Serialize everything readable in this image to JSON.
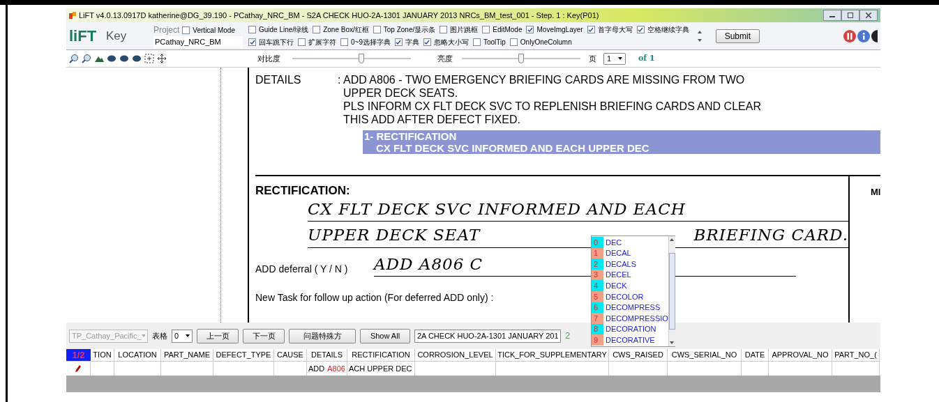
{
  "window": {
    "title": "LiFT v4.0.13.0917D katherine@DG_39.190 - PCathay_NRC_BM - S2A CHECK HUO-2A-1301 JANUARY 2013 NRCs_BM_test_001 - Step. 1 : Key(P01)"
  },
  "toolbar": {
    "logo": "liFT",
    "mode": "Key",
    "project_label": "Project",
    "project_value": "PCathay_NRC_BM",
    "submit": "Submit",
    "options_row_1": [
      {
        "label": "Vertical Mode",
        "checked": false
      },
      {
        "label": "Guide Line/绿线",
        "checked": false
      },
      {
        "label": "Zone Box/红框",
        "checked": false
      },
      {
        "label": "Top Zone/显示条",
        "checked": false
      },
      {
        "label": "图片跳框",
        "checked": false
      },
      {
        "label": "EditMode",
        "checked": false
      },
      {
        "label": "MoveImgLayer",
        "checked": true
      },
      {
        "label": "首字母大写",
        "checked": true
      },
      {
        "label": "空格继续字典",
        "checked": true
      }
    ],
    "options_row_2": [
      {
        "label": "回车跳下行",
        "checked": true
      },
      {
        "label": "扩展字符",
        "checked": false
      },
      {
        "label": "0~9选择字典",
        "checked": false
      },
      {
        "label": "字典",
        "checked": true
      },
      {
        "label": "忽略大小写",
        "checked": true
      },
      {
        "label": "ToolTip",
        "checked": false
      },
      {
        "label": "OnlyOneColumn",
        "checked": false
      }
    ]
  },
  "image_toolbar": {
    "contrast_label": "对比度",
    "contrast": {
      "level": 0.58
    },
    "brightness_label": "亮度",
    "brightness": {
      "level": 0.5
    },
    "page_label": "页",
    "page": "1",
    "page_of": "of 1"
  },
  "document": {
    "details_label": "DETAILS",
    "details_lines": [
      ": ADD A806 - TWO EMERGENCY BRIEFING CARDS ARE MISSING FROM TWO",
      "UPPER DECK SEATS.",
      "PLS INFORM CX FLT DECK SVC TO REPLENISH BRIEFING CARDS AND CLEAR",
      "THIS ADD AFTER DEFECT FIXED."
    ],
    "highlight": [
      "1- RECTIFICATION",
      "CX FLT DECK SVC INFORMED AND EACH UPPER DEC"
    ],
    "rectification_label": "RECTIFICATION:",
    "side_label": "MI",
    "handwriting": [
      "CX FLT DECK SVC INFORMED AND EACH",
      "UPPER DECK SEAT",
      "BRIEFING CARD."
    ],
    "deferral_label": "ADD deferral ( Y / N )",
    "deferral_handwriting": "ADD A806 C",
    "new_task_label": "New Task for follow up action (For deferred ADD only) :"
  },
  "dictionary": [
    {
      "index": "0",
      "word": "DEC",
      "color": "#00e8f0"
    },
    {
      "index": "1",
      "word": "DECAL",
      "color": "#f0a088"
    },
    {
      "index": "2",
      "word": "DECALS",
      "color": "#00e8f0"
    },
    {
      "index": "3",
      "word": "DECEL",
      "color": "#f0a088"
    },
    {
      "index": "4",
      "word": "DECK",
      "color": "#00e8f0"
    },
    {
      "index": "5",
      "word": "DECOLOR",
      "color": "#f0a088"
    },
    {
      "index": "6",
      "word": "DECOMPRESS",
      "color": "#00e8f0"
    },
    {
      "index": "7",
      "word": "DECOMPRESSIO",
      "color": "#f0a088"
    },
    {
      "index": "8",
      "word": "DECORATION",
      "color": "#00e8f0"
    },
    {
      "index": "9",
      "word": "DECORATIVE",
      "color": "#f0a088"
    }
  ],
  "bottom_bar": {
    "template": "TP_Cathay_Pacific_",
    "table_label": "表格",
    "table_value": "0",
    "buttons": [
      "上一页",
      "下一页",
      "问题特殊方",
      "Show All"
    ],
    "document_select": "2A CHECK HUO-2A-1301 JANUARY 201",
    "count": "2"
  },
  "table": {
    "page": "1/2",
    "columns": [
      {
        "label": "TION"
      },
      {
        "label": "LOCATION"
      },
      {
        "label": "PART_NAME"
      },
      {
        "label": "DEFECT_TYPE"
      },
      {
        "label": "CAUSE"
      },
      {
        "label": "DETAILS",
        "cell": "ADD",
        "cell_marked": "A806"
      },
      {
        "label": "RECTIFICATION",
        "cell": "ACH UPPER DEC"
      },
      {
        "label": "CORROSION_LEVEL"
      },
      {
        "label": "TICK_FOR_SUPPLEMENTARY"
      },
      {
        "label": "CWS_RAISED"
      },
      {
        "label": "CWS_SERIAL_NO"
      },
      {
        "label": "DATE"
      },
      {
        "label": "APPROVAL_NO"
      },
      {
        "label": "PART_NO_("
      }
    ]
  }
}
